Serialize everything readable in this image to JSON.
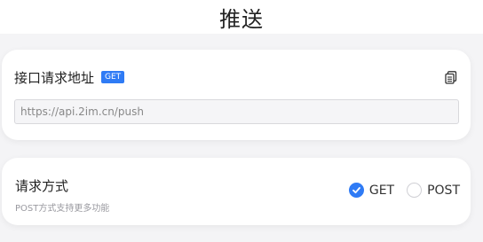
{
  "header": {
    "title": "推送"
  },
  "endpoint": {
    "label": "接口请求地址",
    "method_badge": "GET",
    "url": "https://api.2im.cn/push"
  },
  "method": {
    "title": "请求方式",
    "subtitle": "POST方式支持更多功能",
    "options": [
      {
        "label": "GET",
        "checked": true
      },
      {
        "label": "POST",
        "checked": false
      }
    ]
  },
  "colors": {
    "accent": "#2f7bf5",
    "background": "#f4f4f6"
  },
  "icons": {
    "copy": "copy-icon",
    "check": "check-icon"
  }
}
